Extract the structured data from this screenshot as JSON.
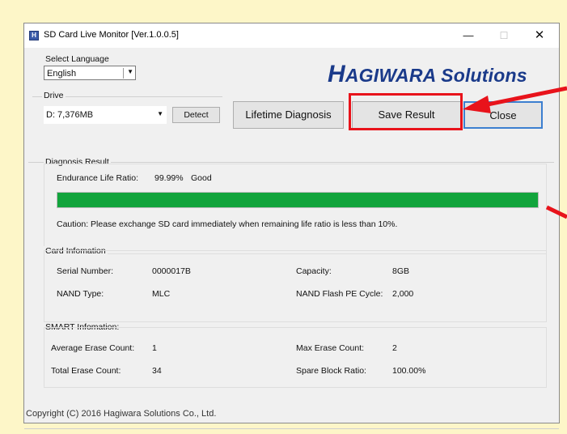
{
  "window": {
    "title": "SD Card Live Monitor [Ver.1.0.0.5]",
    "app_icon_glyph": "H",
    "controls": {
      "minimize": "—",
      "maximize": "☐",
      "close": "✕"
    }
  },
  "language": {
    "label": "Select Language",
    "selected": "English"
  },
  "drive": {
    "label": "Drive",
    "selected": "D: 7,376MB",
    "detect_label": "Detect"
  },
  "logo": {
    "initial": "H",
    "rest": "AGIWARA Solutions"
  },
  "buttons": {
    "lifetime": "Lifetime Diagnosis",
    "save": "Save Result",
    "close": "Close"
  },
  "diagnosis": {
    "title": "Diagnosis Result",
    "ratio_label": "Endurance Life Ratio:",
    "ratio_value": "99.99%",
    "status": "Good",
    "bar_level": 0.9999,
    "bar_color": "#12a43c",
    "caution": "Caution: Please exchange SD card immediately when remaining life ratio is less than 10%."
  },
  "card_info": {
    "title": "Card Infomation",
    "serial_label": "Serial Number:",
    "serial_value": "0000017B",
    "capacity_label": "Capacity:",
    "capacity_value": "8GB",
    "nand_type_label": "NAND Type:",
    "nand_type_value": "MLC",
    "pe_label": "NAND Flash PE Cycle:",
    "pe_value": "2,000"
  },
  "smart_info": {
    "title": "SMART Infomation:",
    "avg_erase_label": "Average Erase Count:",
    "avg_erase_value": "1",
    "max_erase_label": "Max Erase Count:",
    "max_erase_value": "2",
    "total_erase_label": "Total Erase Count:",
    "total_erase_value": "34",
    "spare_label": "Spare Block Ratio:",
    "spare_value": "100.00%"
  },
  "status_bar": {
    "copyright": "Copyright (C) 2016 Hagiwara Solutions Co., Ltd."
  },
  "colors": {
    "accent": "#3c7fd0",
    "logo": "#1a3a8a",
    "annotation": "#e8131b",
    "background": "#fdf6c8"
  }
}
